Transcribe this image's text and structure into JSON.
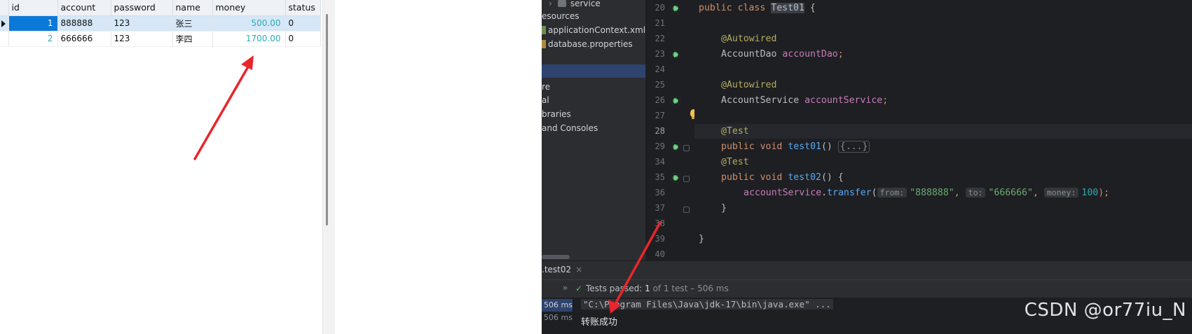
{
  "db": {
    "columns": [
      "id",
      "account",
      "password",
      "name",
      "money",
      "status"
    ],
    "rows": [
      {
        "id": "1",
        "account": "888888",
        "password": "123",
        "name": "张三",
        "money": "500.00",
        "status": "0"
      },
      {
        "id": "2",
        "account": "666666",
        "password": "123",
        "name": "李四",
        "money": "1700.00",
        "status": "0"
      }
    ]
  },
  "project": {
    "items": [
      "service",
      "esources",
      "applicationContext.xml",
      "database.properties",
      "re",
      "al",
      "braries",
      "and Consoles"
    ]
  },
  "editor": {
    "line_numbers": [
      "20",
      "21",
      "22",
      "23",
      "24",
      "25",
      "26",
      "27",
      "28",
      "29",
      "34",
      "35",
      "36",
      "37",
      "38",
      "39",
      "40"
    ],
    "class_decl": {
      "kw1": "public",
      "kw2": "class",
      "name": "Test01",
      "brace": " {"
    },
    "ann1": "@Autowired",
    "field1": {
      "type": "AccountDao ",
      "name": "accountDao",
      "semi": ";"
    },
    "ann2": "@Autowired",
    "field2": {
      "type": "AccountService ",
      "name": "accountService",
      "semi": ";"
    },
    "ann3": "@Test",
    "method1": {
      "kw1": "public",
      "kw2": "void",
      "name": "test01",
      "parens": "() ",
      "folded": "{...}"
    },
    "ann4": "@Test",
    "method2": {
      "kw1": "public",
      "kw2": "void",
      "name": "test02",
      "parens": "() {"
    },
    "call": {
      "obj": "accountService",
      "dot": ".",
      "fn": "transfer",
      "open": "(",
      "hint_from": "from:",
      "from": "\"888888\"",
      "sep1": ", ",
      "hint_to": "to:",
      "to": "\"666666\"",
      "sep2": ", ",
      "hint_money": "money:",
      "money": "100",
      "close": ");"
    },
    "close_method": "}",
    "close_class": "}"
  },
  "bottom": {
    "run_tab": ".test02",
    "run_tab_close": "×",
    "chevrons": "»",
    "tests_passed_label": "Tests passed:",
    "tests_passed_count": "1",
    "tests_passed_detail": "of 1 test – 506 ms",
    "durations": [
      "506 ms",
      "506 ms"
    ],
    "console_cmd": "\"C:\\Program Files\\Java\\jdk-17\\bin\\java.exe\" ...",
    "console_out": "转账成功"
  },
  "watermark": "CSDN @or77iu_N",
  "colors": {
    "arrow": "#e8262b",
    "selection": "#0a79d8",
    "ide_bg": "#1e1f22"
  }
}
